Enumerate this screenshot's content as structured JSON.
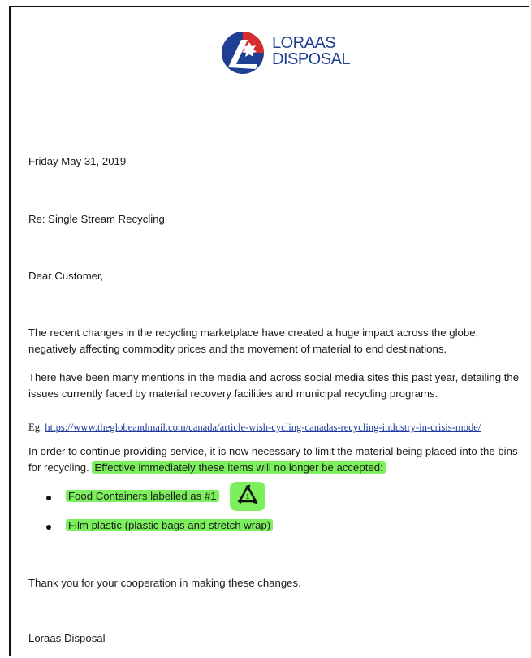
{
  "brand": {
    "line1": "LORAAS",
    "line2": "DISPOSAL"
  },
  "letter": {
    "date": "Friday May 31, 2019",
    "subject": "Re:  Single Stream Recycling",
    "salutation": "Dear Customer,",
    "p1_line1": "The recent changes in the recycling marketplace have created a huge impact across the globe,",
    "p1_line2": "negatively affecting commodity prices and the movement of material to end destinations.",
    "p2_line1": "There have been many mentions in the media and across social media sites this past year, detailing the",
    "p2_line2": "issues currently faced by material recovery facilities and municipal recycling programs.",
    "eg_prefix": "Eg. ",
    "eg_link": "https://www.theglobeandmail.com/canada/article-wish-cycling-canadas-recycling-industry-in-crisis-mode/",
    "p3_line1": "In order to continue providing service, it is now necessary to limit the material being placed into the bins",
    "p3_line2_start": "for recycling. ",
    "p3_highlight": "Effective immediately these items will no longer be accepted:",
    "items": [
      "Food Containers labelled as #1",
      "Film plastic (plastic bags and stretch wrap)"
    ],
    "recycle_code": "1",
    "thanks": "Thank you for your cooperation in making these changes.",
    "signature": "Loraas Disposal"
  },
  "colors": {
    "highlight": "#7cf05c",
    "brand_blue": "#1f3f93",
    "brand_red": "#d62d2d",
    "link": "#1f3a9e"
  }
}
